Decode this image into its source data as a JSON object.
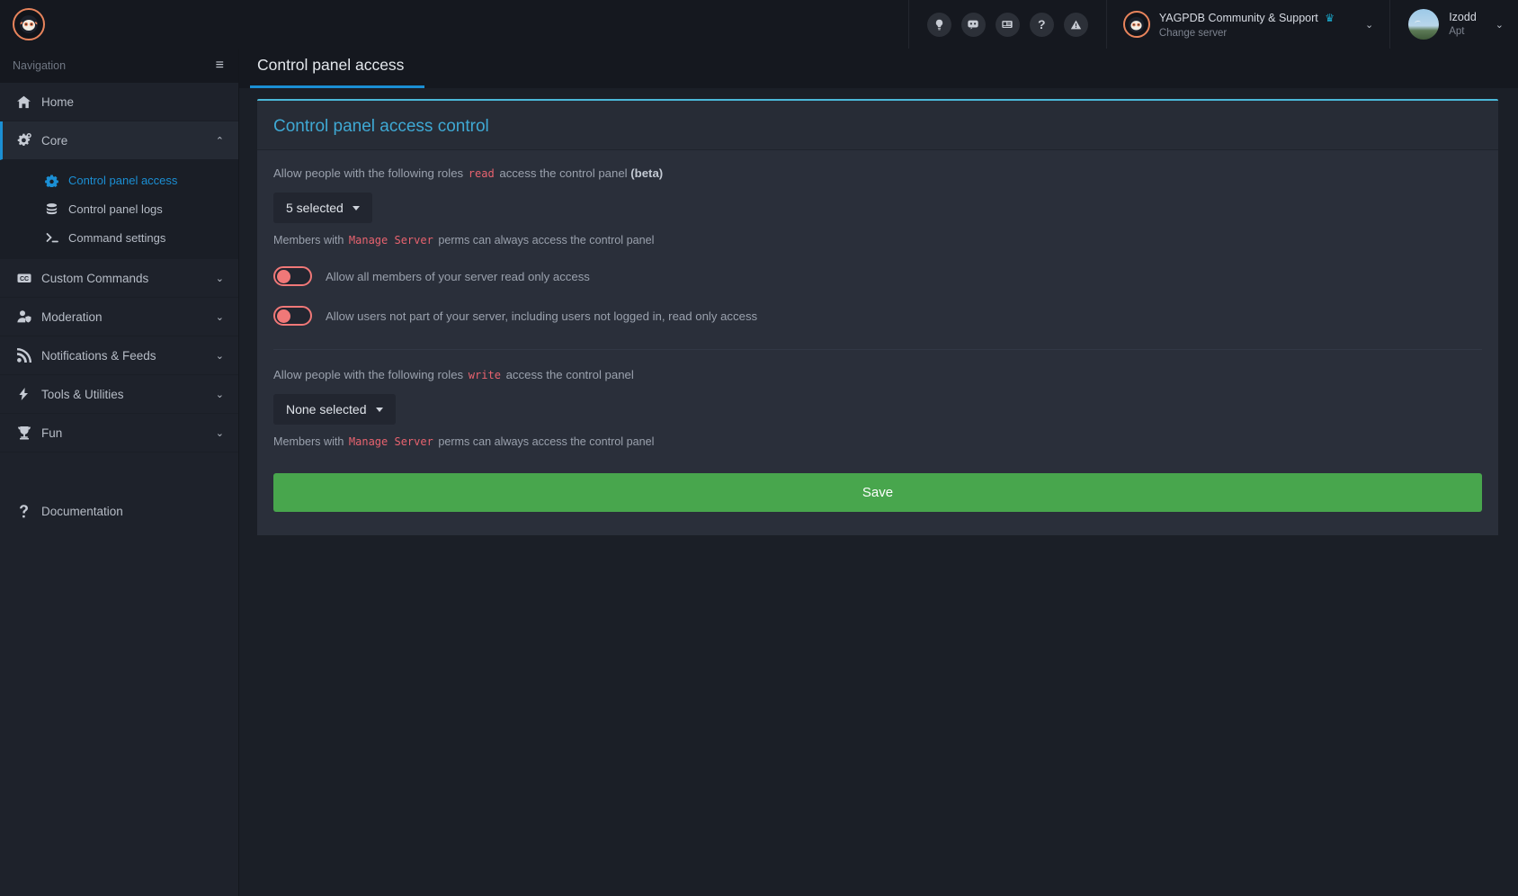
{
  "topbar": {
    "brand_icon": "yagpdb-logo-icon",
    "icons": [
      {
        "name": "lightbulb-icon",
        "glyph": "idea"
      },
      {
        "name": "discord-icon",
        "glyph": "discord"
      },
      {
        "name": "news-icon",
        "glyph": "news"
      },
      {
        "name": "help-icon",
        "glyph": "?"
      },
      {
        "name": "warning-icon",
        "glyph": "warning"
      }
    ],
    "server": {
      "name": "YAGPDB Community & Support",
      "crown": "♛",
      "change_label": "Change server",
      "chevron": "⌄"
    },
    "user": {
      "name": "Izodd",
      "sub": "Apt",
      "chevron": "⌄"
    }
  },
  "sidebar": {
    "nav_label": "Navigation",
    "hamburger": "≡",
    "items": [
      {
        "label": "Home",
        "icon": "home-icon",
        "caret": "",
        "active": false
      },
      {
        "label": "Core",
        "icon": "gears-icon",
        "caret": "⌃",
        "active": true
      },
      {
        "label": "Custom Commands",
        "icon": "cc-icon",
        "caret": "⌄",
        "active": false
      },
      {
        "label": "Moderation",
        "icon": "moderation-icon",
        "caret": "⌄",
        "active": false
      },
      {
        "label": "Notifications & Feeds",
        "icon": "rss-icon",
        "caret": "⌄",
        "active": false
      },
      {
        "label": "Tools & Utilities",
        "icon": "bolt-icon",
        "caret": "⌄",
        "active": false
      },
      {
        "label": "Fun",
        "icon": "trophy-icon",
        "caret": "⌄",
        "active": false
      }
    ],
    "subitems": [
      {
        "label": "Control panel access",
        "icon": "gear-icon",
        "current": true
      },
      {
        "label": "Control panel logs",
        "icon": "database-icon",
        "current": false
      },
      {
        "label": "Command settings",
        "icon": "terminal-icon",
        "current": false
      }
    ],
    "documentation": {
      "label": "Documentation",
      "icon": "question-icon"
    }
  },
  "page": {
    "title": "Control panel access"
  },
  "card": {
    "title": "Control panel access control",
    "read_row": {
      "prefix": "Allow people with the following roles",
      "code": "read",
      "middle": "access the control panel",
      "bold": "(beta)",
      "dropdown_value": "5 selected",
      "hint_prefix": "Members with",
      "hint_code": "Manage Server",
      "hint_suffix": "perms can always access the control panel"
    },
    "toggles": [
      {
        "label": "Allow all members of your server read only access",
        "state": "off"
      },
      {
        "label": "Allow users not part of your server, including users not logged in, read only access",
        "state": "off"
      }
    ],
    "write_row": {
      "prefix": "Allow people with the following roles",
      "code": "write",
      "middle": "access the control panel",
      "dropdown_value": "None selected",
      "hint_prefix": "Members with",
      "hint_code": "Manage Server",
      "hint_suffix": "perms can always access the control panel"
    },
    "save_label": "Save"
  },
  "colors": {
    "accent_blue": "#1b8fd4",
    "card_accent": "#4bb8d8",
    "code_red": "#e8636f",
    "toggle_off": "#f07878",
    "save_green": "#48a64d",
    "brand_orange": "#e8845c",
    "crown_cyan": "#1aa5c8"
  }
}
